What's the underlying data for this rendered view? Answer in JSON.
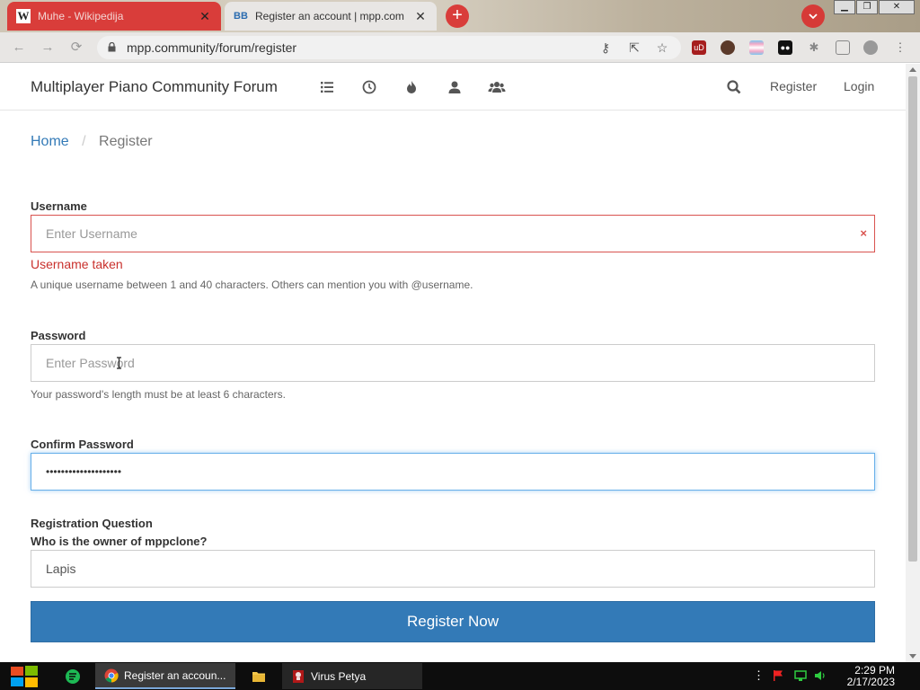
{
  "browser": {
    "tabs": [
      {
        "title": "Muhe - Wikipedija",
        "favicon": "wikipedia-icon",
        "active": false
      },
      {
        "title": "Register an account | mpp.com",
        "favicon": "nodebb-icon",
        "active": true
      }
    ],
    "address": "mpp.community/forum/register"
  },
  "header": {
    "brand": "Multiplayer Piano Community Forum",
    "nav_icons": [
      "list-icon",
      "clock-icon",
      "fire-icon",
      "user-icon",
      "users-icon"
    ],
    "search_icon": "search-icon",
    "register_label": "Register",
    "login_label": "Login"
  },
  "breadcrumb": {
    "home": "Home",
    "separator": "/",
    "current": "Register"
  },
  "form": {
    "username": {
      "label": "Username",
      "placeholder": "Enter Username",
      "clear_glyph": "×",
      "error": "Username taken",
      "help": "A unique username between 1 and 40 characters. Others can mention you with @username."
    },
    "password": {
      "label": "Password",
      "placeholder": "Enter Password",
      "help": "Your password's length must be at least 6 characters."
    },
    "confirm": {
      "label": "Confirm Password",
      "value": "••••••••••••••••••••"
    },
    "question": {
      "label": "Registration Question",
      "prompt": "Who is the owner of mppclone?",
      "value": "Lapis"
    },
    "submit_label": "Register Now"
  },
  "taskbar": {
    "items": [
      {
        "label": "Register an accoun...",
        "icon": "chrome-icon"
      },
      {
        "label": "",
        "icon": "folder-icon"
      },
      {
        "label": "Virus Petya",
        "icon": "petya-icon"
      }
    ],
    "time": "2:29 PM",
    "date": "2/17/2023"
  },
  "colors": {
    "primary": "#337ab7",
    "error": "#d9534f",
    "focus": "#66afe9"
  }
}
